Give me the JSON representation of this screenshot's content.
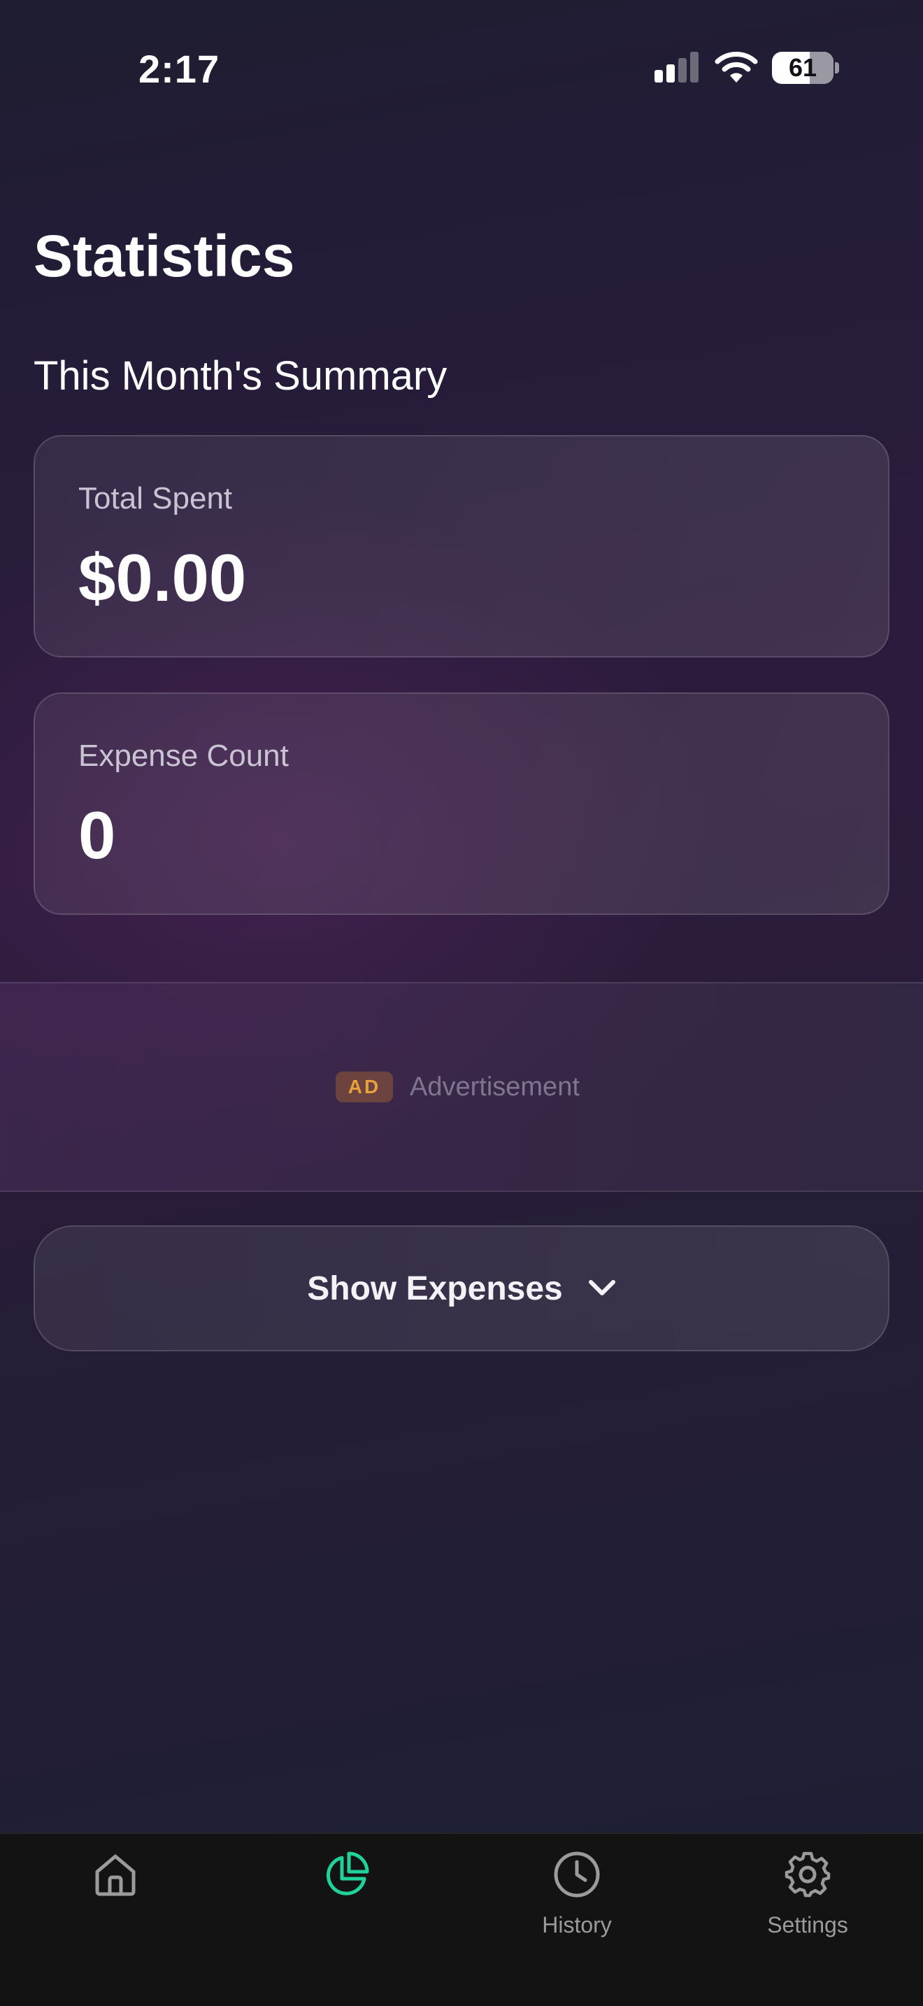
{
  "status_bar": {
    "time": "2:17",
    "battery_level": "61",
    "icons": [
      "signal-icon",
      "wifi-icon",
      "battery-icon"
    ]
  },
  "page": {
    "title": "Statistics",
    "section_title": "This Month's Summary"
  },
  "summary": {
    "total_spent_label": "Total Spent",
    "total_spent_value": "$0.00",
    "expense_count_label": "Expense Count",
    "expense_count_value": "0"
  },
  "ad": {
    "badge": "AD",
    "text": "Advertisement"
  },
  "expenses_toggle": {
    "label": "Show Expenses",
    "icon": "chevron-down-icon"
  },
  "tab_bar": {
    "active_color": "#1fd19a",
    "inactive_color": "#9b9b9b",
    "tabs": [
      {
        "icon": "home-icon",
        "label": "",
        "active": false
      },
      {
        "icon": "pie-chart-icon",
        "label": "",
        "active": true
      },
      {
        "icon": "clock-icon",
        "label": "History",
        "active": false
      },
      {
        "icon": "gear-icon",
        "label": "Settings",
        "active": false
      }
    ]
  },
  "colors": {
    "background_top": "#1e1d31",
    "background_mid": "#2d1b3d",
    "background_bottom": "#1c2034",
    "ad_badge": "#e9a23b"
  }
}
